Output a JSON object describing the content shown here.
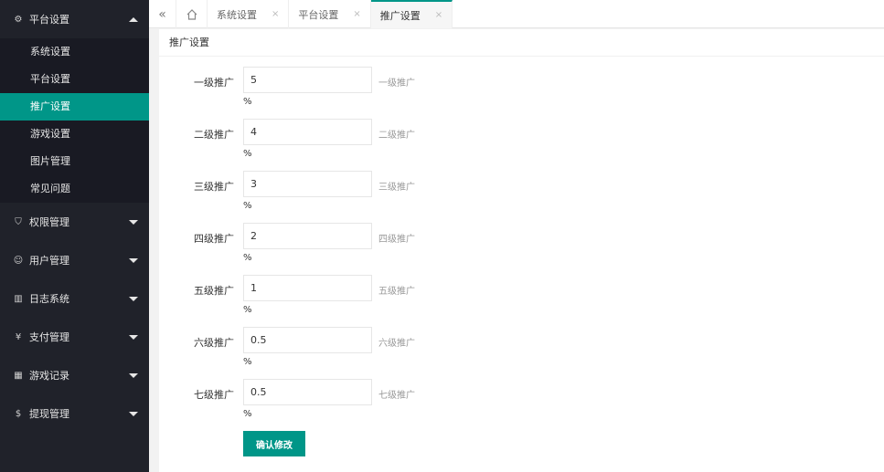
{
  "sidebar": {
    "platform": {
      "label": "平台设置",
      "items": [
        "系统设置",
        "平台设置",
        "推广设置",
        "游戏设置",
        "图片管理",
        "常见问题"
      ],
      "active_index": 2
    },
    "groups": [
      {
        "label": "权限管理",
        "icon": "shield-icon"
      },
      {
        "label": "用户管理",
        "icon": "user-icon"
      },
      {
        "label": "日志系统",
        "icon": "book-icon"
      },
      {
        "label": "支付管理",
        "icon": "yen-icon"
      },
      {
        "label": "游戏记录",
        "icon": "grid-icon"
      },
      {
        "label": "提现管理",
        "icon": "dollar-icon"
      }
    ]
  },
  "topbar": {
    "tabs": [
      {
        "label": "系统设置",
        "close": "×"
      },
      {
        "label": "平台设置",
        "close": "×"
      },
      {
        "label": "推广设置",
        "close": "×"
      }
    ]
  },
  "card": {
    "title": "推广设置"
  },
  "form": {
    "rows": [
      {
        "label": "一级推广",
        "value": "5",
        "tip": "一级推广",
        "unit": "%"
      },
      {
        "label": "二级推广",
        "value": "4",
        "tip": "二级推广",
        "unit": "%"
      },
      {
        "label": "三级推广",
        "value": "3",
        "tip": "三级推广",
        "unit": "%"
      },
      {
        "label": "四级推广",
        "value": "2",
        "tip": "四级推广",
        "unit": "%"
      },
      {
        "label": "五级推广",
        "value": "1",
        "tip": "五级推广",
        "unit": "%"
      },
      {
        "label": "六级推广",
        "value": "0.5",
        "tip": "六级推广",
        "unit": "%"
      },
      {
        "label": "七级推广",
        "value": "0.5",
        "tip": "七级推广",
        "unit": "%"
      }
    ],
    "submit_label": "确认修改"
  },
  "colors": {
    "accent": "#009688",
    "sidebar_bg": "#20222a",
    "submenu_bg": "#191a23"
  }
}
